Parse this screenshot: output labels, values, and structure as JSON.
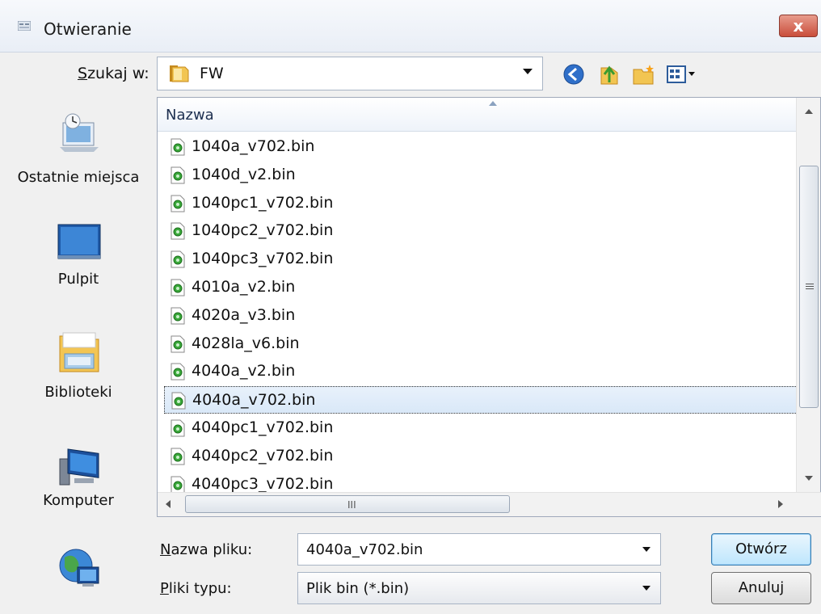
{
  "window": {
    "title": "Otwieranie",
    "close_label": "x"
  },
  "lookin": {
    "label_prefix": "S",
    "label_rest": "zukaj w:",
    "value": "FW"
  },
  "places": [
    {
      "label": "Ostatnie miejsca",
      "icon": "recent-places-icon"
    },
    {
      "label": "Pulpit",
      "icon": "desktop-icon"
    },
    {
      "label": "Biblioteki",
      "icon": "libraries-icon"
    },
    {
      "label": "Komputer",
      "icon": "computer-icon"
    },
    {
      "label": "",
      "icon": "network-icon"
    }
  ],
  "filelist": {
    "column_header": "Nazwa",
    "files": [
      "1040a_v702.bin",
      "1040d_v2.bin",
      "1040pc1_v702.bin",
      "1040pc2_v702.bin",
      "1040pc3_v702.bin",
      "4010a_v2.bin",
      "4020a_v3.bin",
      "4028la_v6.bin",
      "4040a_v2.bin",
      "4040a_v702.bin",
      "4040pc1_v702.bin",
      "4040pc2_v702.bin",
      "4040pc3_v702.bin"
    ],
    "selected_index": 9,
    "hscroll_grip": "III"
  },
  "filename": {
    "label_prefix": "N",
    "label_rest": "azwa pliku:",
    "value": "4040a_v702.bin"
  },
  "filetype": {
    "label_prefix": "P",
    "label_rest": "liki typu:",
    "value": "Plik bin (*.bin)"
  },
  "buttons": {
    "open": "Otwórz",
    "cancel": "Anuluj"
  },
  "colors": {
    "selection": "#d9e8f8",
    "close": "#c94e3b",
    "default_button": "#bee6fd"
  }
}
